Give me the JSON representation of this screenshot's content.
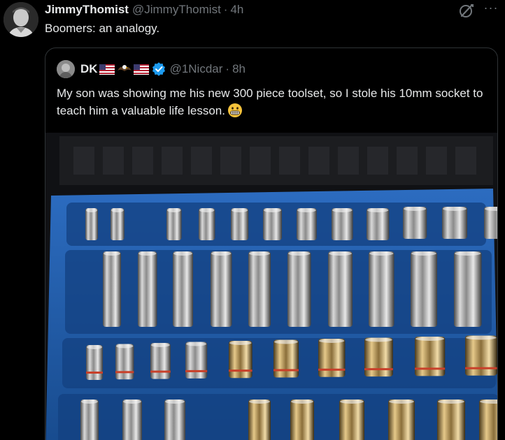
{
  "tweet": {
    "display_name": "JimmyThomist",
    "handle": "@JimmyThomist",
    "separator": "·",
    "time": "4h",
    "text": "Boomers: an analogy.",
    "avatar_icon": "user-avatar"
  },
  "header_actions": {
    "grok_icon": "grok-icon",
    "more_icon": "more-icon",
    "more_label": "···"
  },
  "quote": {
    "display_name": "DK",
    "handle": "@1Nicdar",
    "separator": "·",
    "time": "8h",
    "text": "My son was showing me his new 300 piece toolset, so I stole his 10mm socket to teach him a valuable life lesson.",
    "name_emojis": [
      "us-flag",
      "eagle",
      "us-flag"
    ],
    "verified_icon": "verified-badge-icon",
    "text_emoji": "grimacing-face",
    "photo_alt": "socket set tray"
  },
  "colors": {
    "background": "#000000",
    "text_primary": "#e7e9ea",
    "text_secondary": "#71767b",
    "border": "#2f3336",
    "verified_blue": "#1d9bf0",
    "tray_blue": "#1f5aa8"
  }
}
